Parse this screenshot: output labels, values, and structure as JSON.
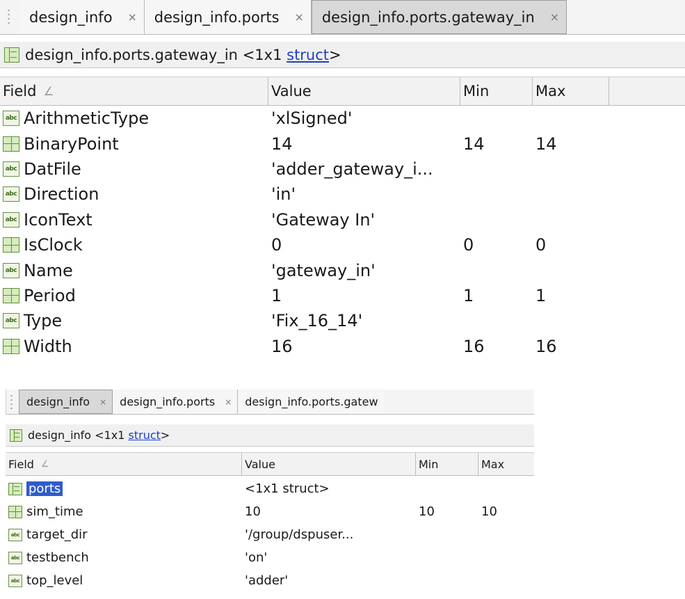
{
  "panel1": {
    "tabs": [
      {
        "label": "design_info",
        "close": "×"
      },
      {
        "label": "design_info.ports",
        "close": "×"
      },
      {
        "label": "design_info.ports.gateway_in",
        "close": "×"
      }
    ],
    "struct_header": {
      "path": "design_info.ports.gateway_in",
      "dims": "<1x1",
      "type_link": "struct",
      "suffix": ">"
    },
    "columns": {
      "field": "Field",
      "sort_mark": "∠",
      "value": "Value",
      "min": "Min",
      "max": "Max"
    },
    "rows": [
      {
        "icon": "abc-icon",
        "field": "ArithmeticType",
        "value": "'xlSigned'",
        "min": "",
        "max": ""
      },
      {
        "icon": "grid-icon",
        "field": "BinaryPoint",
        "value": "14",
        "min": "14",
        "max": "14"
      },
      {
        "icon": "abc-icon",
        "field": "DatFile",
        "value": "'adder_gateway_i...",
        "min": "",
        "max": ""
      },
      {
        "icon": "abc-icon",
        "field": "Direction",
        "value": "'in'",
        "min": "",
        "max": ""
      },
      {
        "icon": "abc-icon",
        "field": "IconText",
        "value": "'Gateway In'",
        "min": "",
        "max": ""
      },
      {
        "icon": "grid-icon",
        "field": "IsClock",
        "value": "0",
        "min": "0",
        "max": "0"
      },
      {
        "icon": "abc-icon",
        "field": "Name",
        "value": "'gateway_in'",
        "min": "",
        "max": ""
      },
      {
        "icon": "grid-icon",
        "field": "Period",
        "value": "1",
        "min": "1",
        "max": "1"
      },
      {
        "icon": "abc-icon",
        "field": "Type",
        "value": "'Fix_16_14'",
        "min": "",
        "max": ""
      },
      {
        "icon": "grid-icon",
        "field": "Width",
        "value": "16",
        "min": "16",
        "max": "16"
      }
    ]
  },
  "panel2": {
    "tabs": [
      {
        "label": "design_info",
        "close": "×"
      },
      {
        "label": "design_info.ports",
        "close": "×"
      },
      {
        "label": "design_info.ports.gatew",
        "close": ""
      }
    ],
    "struct_header": {
      "path": "design_info",
      "dims": "<1x1",
      "type_link": "struct",
      "suffix": ">"
    },
    "columns": {
      "field": "Field",
      "sort_mark": "∠",
      "value": "Value",
      "min": "Min",
      "max": "Max"
    },
    "rows": [
      {
        "icon": "struct-icon",
        "field": "ports",
        "value": "<1x1 struct>",
        "min": "",
        "max": "",
        "selected": true
      },
      {
        "icon": "grid-icon",
        "field": "sim_time",
        "value": "10",
        "min": "10",
        "max": "10"
      },
      {
        "icon": "abc-icon",
        "field": "target_dir",
        "value": "'/group/dspuser...",
        "min": "",
        "max": ""
      },
      {
        "icon": "abc-icon",
        "field": "testbench",
        "value": "'on'",
        "min": "",
        "max": ""
      },
      {
        "icon": "abc-icon",
        "field": "top_level",
        "value": "'adder'",
        "min": "",
        "max": ""
      }
    ]
  },
  "icon_labels": {
    "abc": "abc"
  }
}
